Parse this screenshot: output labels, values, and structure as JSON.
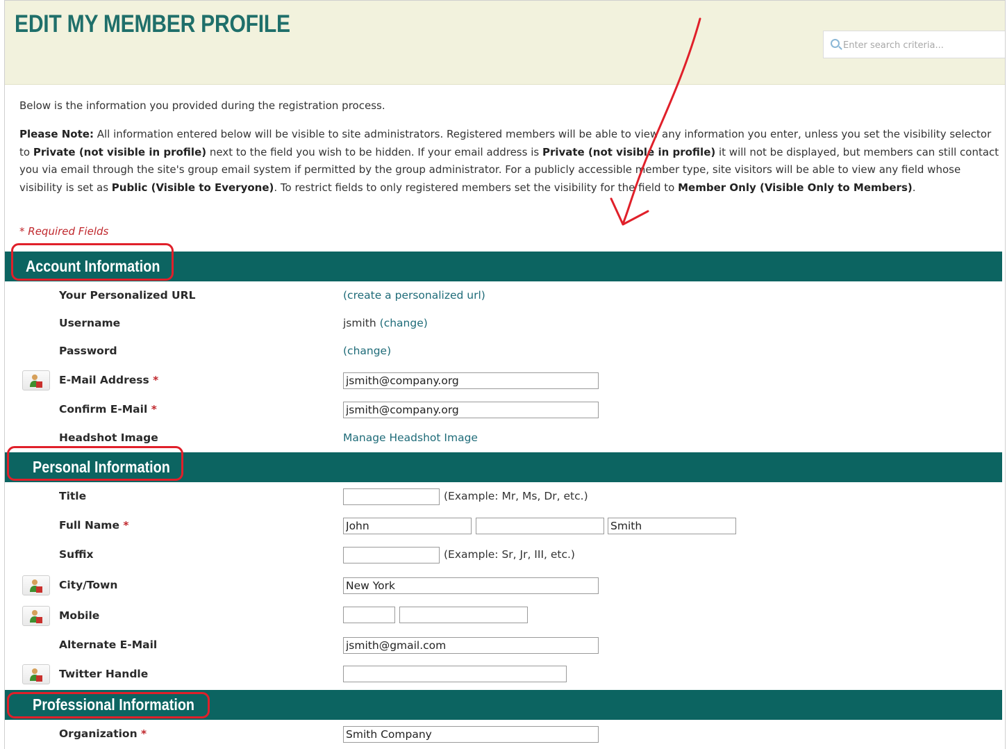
{
  "header": {
    "title": "EDIT MY MEMBER PROFILE",
    "search_placeholder": "Enter search criteria..."
  },
  "intro": "Below is the information you provided during the registration process.",
  "note": {
    "p1_label": "Please Note:",
    "p1_text": " All information entered below will be visible to site administrators. Registered members will be able to view any information you enter, unless you set the visibility selector to ",
    "private1": "Private (not visible in profile)",
    "p2_text": " next to the field you wish to be hidden. If your email address is ",
    "private2": "Private (not visible in profile)",
    "p3_text": " it will not be displayed, but members can still contact you via email through the site's group email system if permitted by the group administrator. For a publicly accessible member type, site visitors will be able to view any field whose visibility is set as ",
    "public": "Public (Visible to Everyone)",
    "p4_text": ". To restrict fields to only registered members set the visibility for the field to ",
    "member_only": "Member Only (Visible Only to Members)",
    "p5_text": "."
  },
  "required_note": "* Required Fields",
  "sections": {
    "account": "Account Information",
    "personal": "Personal Information",
    "professional": "Professional Information"
  },
  "account": {
    "url_label": "Your Personalized URL",
    "url_link": "(create a personalized url)",
    "username_label": "Username",
    "username_value": "jsmith",
    "username_link": "(change)",
    "password_label": "Password",
    "password_link": "(change)",
    "email_label": "E-Mail Address",
    "email_value": "jsmith@company.org",
    "confirm_label": "Confirm E-Mail",
    "confirm_value": "jsmith@company.org",
    "headshot_label": "Headshot Image",
    "headshot_link": "Manage Headshot Image"
  },
  "personal": {
    "title_label": "Title",
    "title_value": "",
    "title_example": "(Example: Mr, Ms, Dr, etc.)",
    "fullname_label": "Full Name",
    "first_value": "John",
    "middle_value": "",
    "last_value": "Smith",
    "suffix_label": "Suffix",
    "suffix_value": "",
    "suffix_example": "(Example: Sr, Jr, III, etc.)",
    "city_label": "City/Town",
    "city_value": "New York",
    "mobile_label": "Mobile",
    "mobile_area": "",
    "mobile_number": "",
    "alt_email_label": "Alternate E-Mail",
    "alt_email_value": "jsmith@gmail.com",
    "twitter_label": "Twitter Handle",
    "twitter_value": ""
  },
  "professional": {
    "org_label": "Organization",
    "org_value": "Smith Company"
  },
  "required_marker": "*",
  "colors": {
    "accent": "#0c6461",
    "title": "#1f6f6a",
    "link": "#1e6b78",
    "required": "#c0282d",
    "annotation": "#e0202a",
    "header_bg": "#f2f2dd"
  },
  "icons": {
    "visibility": "person-visibility-icon",
    "search": "search-icon"
  }
}
